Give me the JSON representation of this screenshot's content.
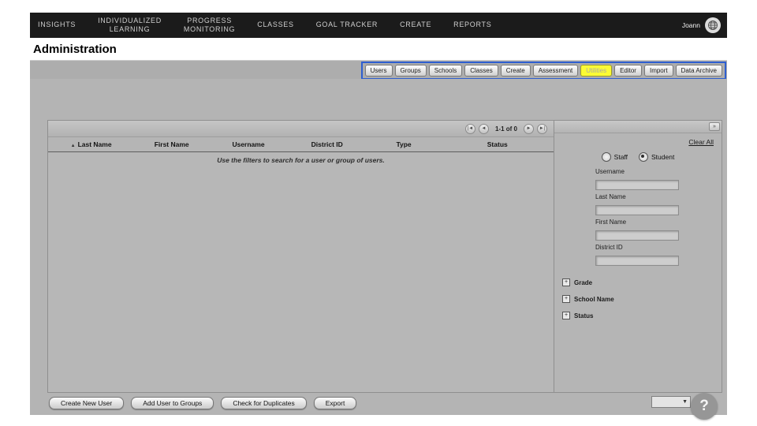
{
  "colors": {
    "annotation_border": "#2e5fd0",
    "tab_active_bg": "#fbfb35",
    "nav_bg": "#1b1b1b"
  },
  "nav": {
    "items": [
      "INSIGHTS",
      "INDIVIDUALIZED\nLEARNING",
      "PROGRESS\nMONITORING",
      "CLASSES",
      "GOAL TRACKER",
      "CREATE",
      "REPORTS"
    ],
    "user": "Joann"
  },
  "page": {
    "title": "Administration"
  },
  "tabs": {
    "items": [
      "Users",
      "Groups",
      "Schools",
      "Classes",
      "Create",
      "Assessment",
      "Utilities",
      "Editor",
      "Import",
      "Data Archive"
    ],
    "active": "Utilities"
  },
  "table": {
    "pagination": {
      "label": "1-1 of 0",
      "first": "|◄",
      "prev": "◄",
      "next": "►",
      "last": "►|"
    },
    "sort_icon": "▲",
    "columns": [
      "Last Name",
      "First Name",
      "Username",
      "District ID",
      "Type",
      "Status"
    ],
    "empty_message": "Use the filters to search for a user or group of users."
  },
  "filters": {
    "collapse": "»",
    "clear_all": "Clear All",
    "radio_options": [
      "Staff",
      "Student"
    ],
    "selected_radio": "Student",
    "fields": [
      "Username",
      "Last Name",
      "First Name",
      "District ID"
    ],
    "expand_icon": "+",
    "sections": [
      "Grade",
      "School Name",
      "Status"
    ]
  },
  "footer": {
    "buttons": [
      "Create New User",
      "Add User to Groups",
      "Check for Duplicates",
      "Export"
    ],
    "select_arrow": "▼",
    "help_label": "?"
  }
}
